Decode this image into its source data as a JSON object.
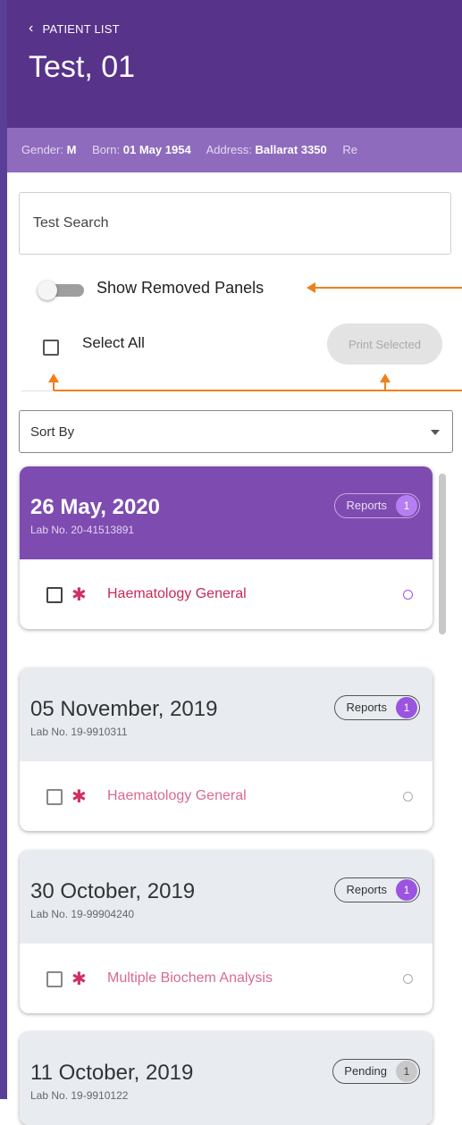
{
  "header": {
    "back_label": "PATIENT LIST",
    "patient_name": "Test, 01"
  },
  "patient_info": {
    "gender_label": "Gender:",
    "gender": "M",
    "born_label": "Born:",
    "born": "01 May 1954",
    "address_label": "Address:",
    "address": "Ballarat 3350",
    "overflow": "Re"
  },
  "search": {
    "placeholder": "Test Search"
  },
  "toggle": {
    "label": "Show Removed Panels",
    "on": false
  },
  "select_all": {
    "label": "Select All",
    "checked": false
  },
  "print_selected": {
    "label": "Print Selected",
    "enabled": false
  },
  "sort": {
    "label": "Sort By"
  },
  "colors": {
    "header": "#57338a",
    "info_bar": "#8e6bbd",
    "active_card": "#7e4cb0",
    "badge_count": "#9b54e0",
    "annotation_arrow": "#f07f1a"
  },
  "cards": [
    {
      "date": "26 May, 2020",
      "lab_no": "Lab No. 20-41513891",
      "badge_label": "Reports",
      "badge_count": "1",
      "panel": "Haematology General",
      "active": true
    },
    {
      "date": "05 November, 2019",
      "lab_no": "Lab No. 19-9910311",
      "badge_label": "Reports",
      "badge_count": "1",
      "panel": "Haematology General",
      "active": false
    },
    {
      "date": "30 October, 2019",
      "lab_no": "Lab No. 19-99904240",
      "badge_label": "Reports",
      "badge_count": "1",
      "panel": "Multiple Biochem Analysis",
      "active": false
    },
    {
      "date": "11 October, 2019",
      "lab_no": "Lab No. 19-9910122",
      "badge_label": "Pending",
      "badge_count": "1",
      "active": false
    }
  ]
}
